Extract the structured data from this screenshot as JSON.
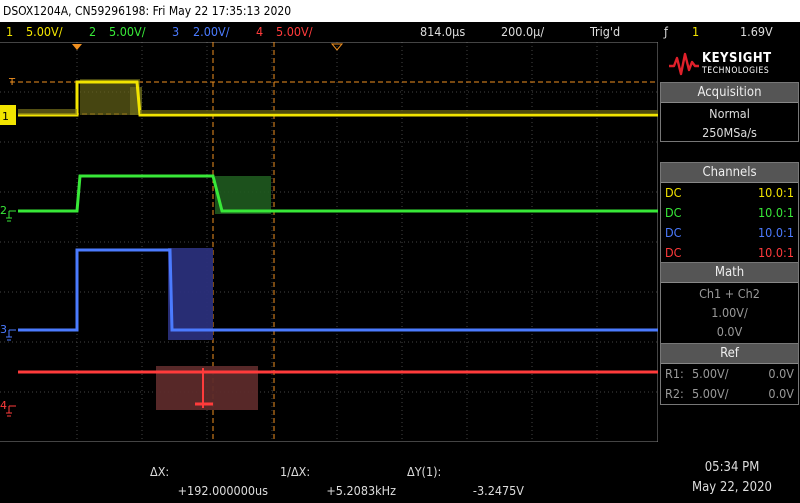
{
  "title_bar": "DSOX1204A, CN59296198: Fri May 22 17:35:13 2020",
  "status": {
    "ch1": {
      "num": "1",
      "scale": "5.00V/",
      "color": "#f2e400"
    },
    "ch2": {
      "num": "2",
      "scale": "5.00V/",
      "color": "#38e838"
    },
    "ch3": {
      "num": "3",
      "scale": "2.00V/",
      "color": "#4b7bff"
    },
    "ch4": {
      "num": "4",
      "scale": "5.00V/",
      "color": "#ff3b3b"
    },
    "delay": "814.0µs",
    "timebase": "200.0µ/",
    "trigger_state": "Trig'd",
    "trigger_icon": "ƒ",
    "trigger_source": "1",
    "trigger_level": "1.69V"
  },
  "logo": {
    "brand": "KEYSIGHT",
    "sub": "TECHNOLOGIES",
    "icon": "keysight-wave-logo"
  },
  "acquisition": {
    "header": "Acquisition",
    "mode": "Normal",
    "rate": "250MSa/s"
  },
  "channels": {
    "header": "Channels",
    "rows": [
      {
        "coupling": "DC",
        "probe": "10.0:1",
        "color": "#f2e400"
      },
      {
        "coupling": "DC",
        "probe": "10.0:1",
        "color": "#38e838"
      },
      {
        "coupling": "DC",
        "probe": "10.0:1",
        "color": "#4b7bff"
      },
      {
        "coupling": "DC",
        "probe": "10.0:1",
        "color": "#ff3b3b"
      }
    ]
  },
  "math": {
    "header": "Math",
    "expr": "Ch1 + Ch2",
    "scale": "1.00V/",
    "offset": "0.0V"
  },
  "ref": {
    "header": "Ref",
    "rows": [
      {
        "name": "R1:",
        "scale": "5.00V/",
        "offset": "0.0V"
      },
      {
        "name": "R2:",
        "scale": "5.00V/",
        "offset": "0.0V"
      }
    ]
  },
  "measurements": {
    "dx_label": "ΔX:",
    "dx_value": "+192.000000us",
    "inv_dx_label": "1/ΔX:",
    "inv_dx_value": "+5.2083kHz",
    "dy_label": "ΔY(1):",
    "dy_value": "-3.2475V"
  },
  "clock": {
    "time": "05:34 PM",
    "date": "May 22, 2020"
  },
  "markers": {
    "ch1": "1",
    "ch2": "2",
    "ch3": "3",
    "ch4": "4",
    "trigger": "T"
  }
}
